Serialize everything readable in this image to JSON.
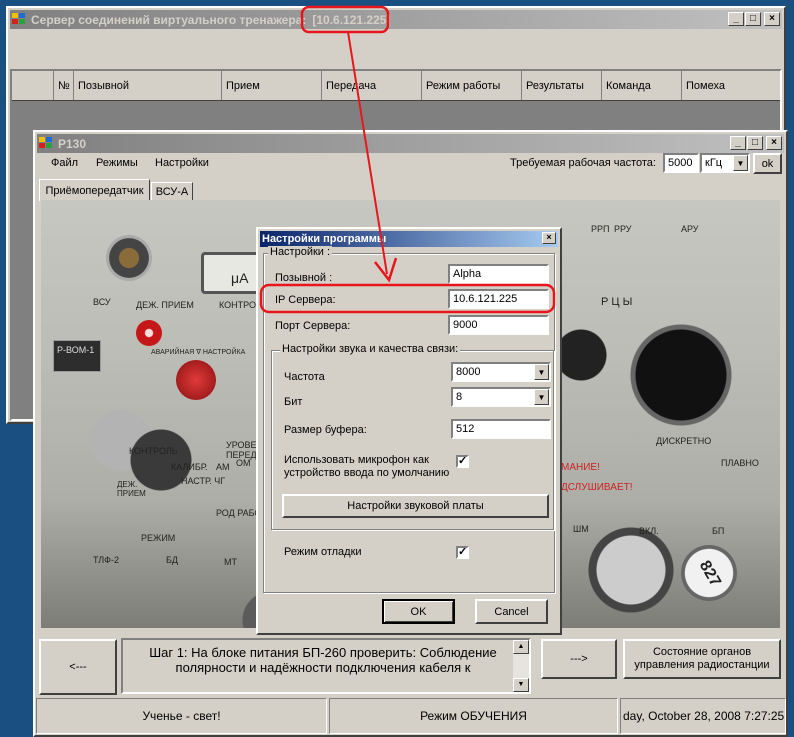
{
  "server_window": {
    "title": "Сервер соединений виртуального тренажера:",
    "ip": "[10.6.121.225]",
    "columns": [
      "№",
      "Позывной",
      "Прием",
      "Передача",
      "Режим работы",
      "Результаты",
      "Команда",
      "Помеха"
    ]
  },
  "main_window": {
    "title": "Р130",
    "menu": [
      "Файл",
      "Режимы",
      "Настройки"
    ],
    "freq_label": "Требуемая рабочая частота:",
    "freq_value": "5000",
    "freq_unit": "кГц",
    "ok_label": "ok",
    "tabs": [
      "Приёмопередатчик",
      "ВСУ-А"
    ],
    "panel_labels": {
      "vsu": "ВСУ",
      "dezh_priem": "ДЕЖ. ПРИЕМ",
      "kontrol": "КОНТРОЛЬ",
      "uA": "μA",
      "avariinaya": "АВАРИЙНАЯ ∇ НАСТРОЙКА",
      "r_vom": "Р-ВОМ-1",
      "kontrol2": "КОНТРОЛЬ",
      "urovni": "УРОВЕНЬ ПЕРЕДАЧИ",
      "kalibr": "КАЛИБР.",
      "nastr_chg": "НАСТР. ЧГ",
      "am": "АМ",
      "om": "ОМ",
      "dezh_priem2": "ДЕЖ. ПРИЕМ",
      "rezhim": "РЕЖИМ",
      "rod_rabot": "РОД РАБОТЫ",
      "tlf": "ТЛФ-2",
      "bd": "БД",
      "mt": "МТ",
      "rrp": "РРП",
      "rru": "РРУ",
      "aru": "АРУ",
      "diskretno": "ДИСКРЕТНО",
      "plavno": "ПЛАВНО",
      "vnimanie": "МАНИЕ!",
      "podslushivaet": "ДСЛУШИВАЕТ!",
      "shm": "ШМ",
      "vkl": "ВКЛ.",
      "bp": "БП",
      "tube_label": "827",
      "letters": "Р   Ц   Ы"
    },
    "nav_prev": "<---",
    "nav_next": "--->",
    "step_text": "Шаг 1: На блоке питания БП-260 проверить: Соблюдение полярности и надёжности подключения кабеля к",
    "state_button": "Состояние органов управления радиостанции",
    "status": {
      "left": "Ученье - свет!",
      "mode": "Режим ОБУЧЕНИЯ",
      "datetime": "day, October 28, 2008  7:27:25"
    }
  },
  "dialog": {
    "title": "Настройки программы",
    "group_label": "Настройки :",
    "callsign_label": "Позывной :",
    "callsign_value": "Alpha",
    "ip_label": "IP Сервера:",
    "ip_value": "10.6.121.225",
    "port_label": "Порт Сервера:",
    "port_value": "9000",
    "sound_group_label": "Настройки звука и качества связи:",
    "freq_label": "Частота",
    "freq_value": "8000",
    "bit_label": "Бит",
    "bit_value": "8",
    "buffer_label": "Размер буфера:",
    "buffer_value": "512",
    "mic_label": "Использовать микрофон как устройство ввода по умолчанию",
    "mic_checked": "✓",
    "soundcard_button": "Настройки звуковой платы",
    "debug_label": "Режим отладки",
    "debug_checked": "✓",
    "ok_label": "OK",
    "cancel_label": "Cancel"
  },
  "colors": {
    "desktop": "#1a4f82",
    "annotation": "#e8161b",
    "titlebar_active": "#0a246a"
  }
}
